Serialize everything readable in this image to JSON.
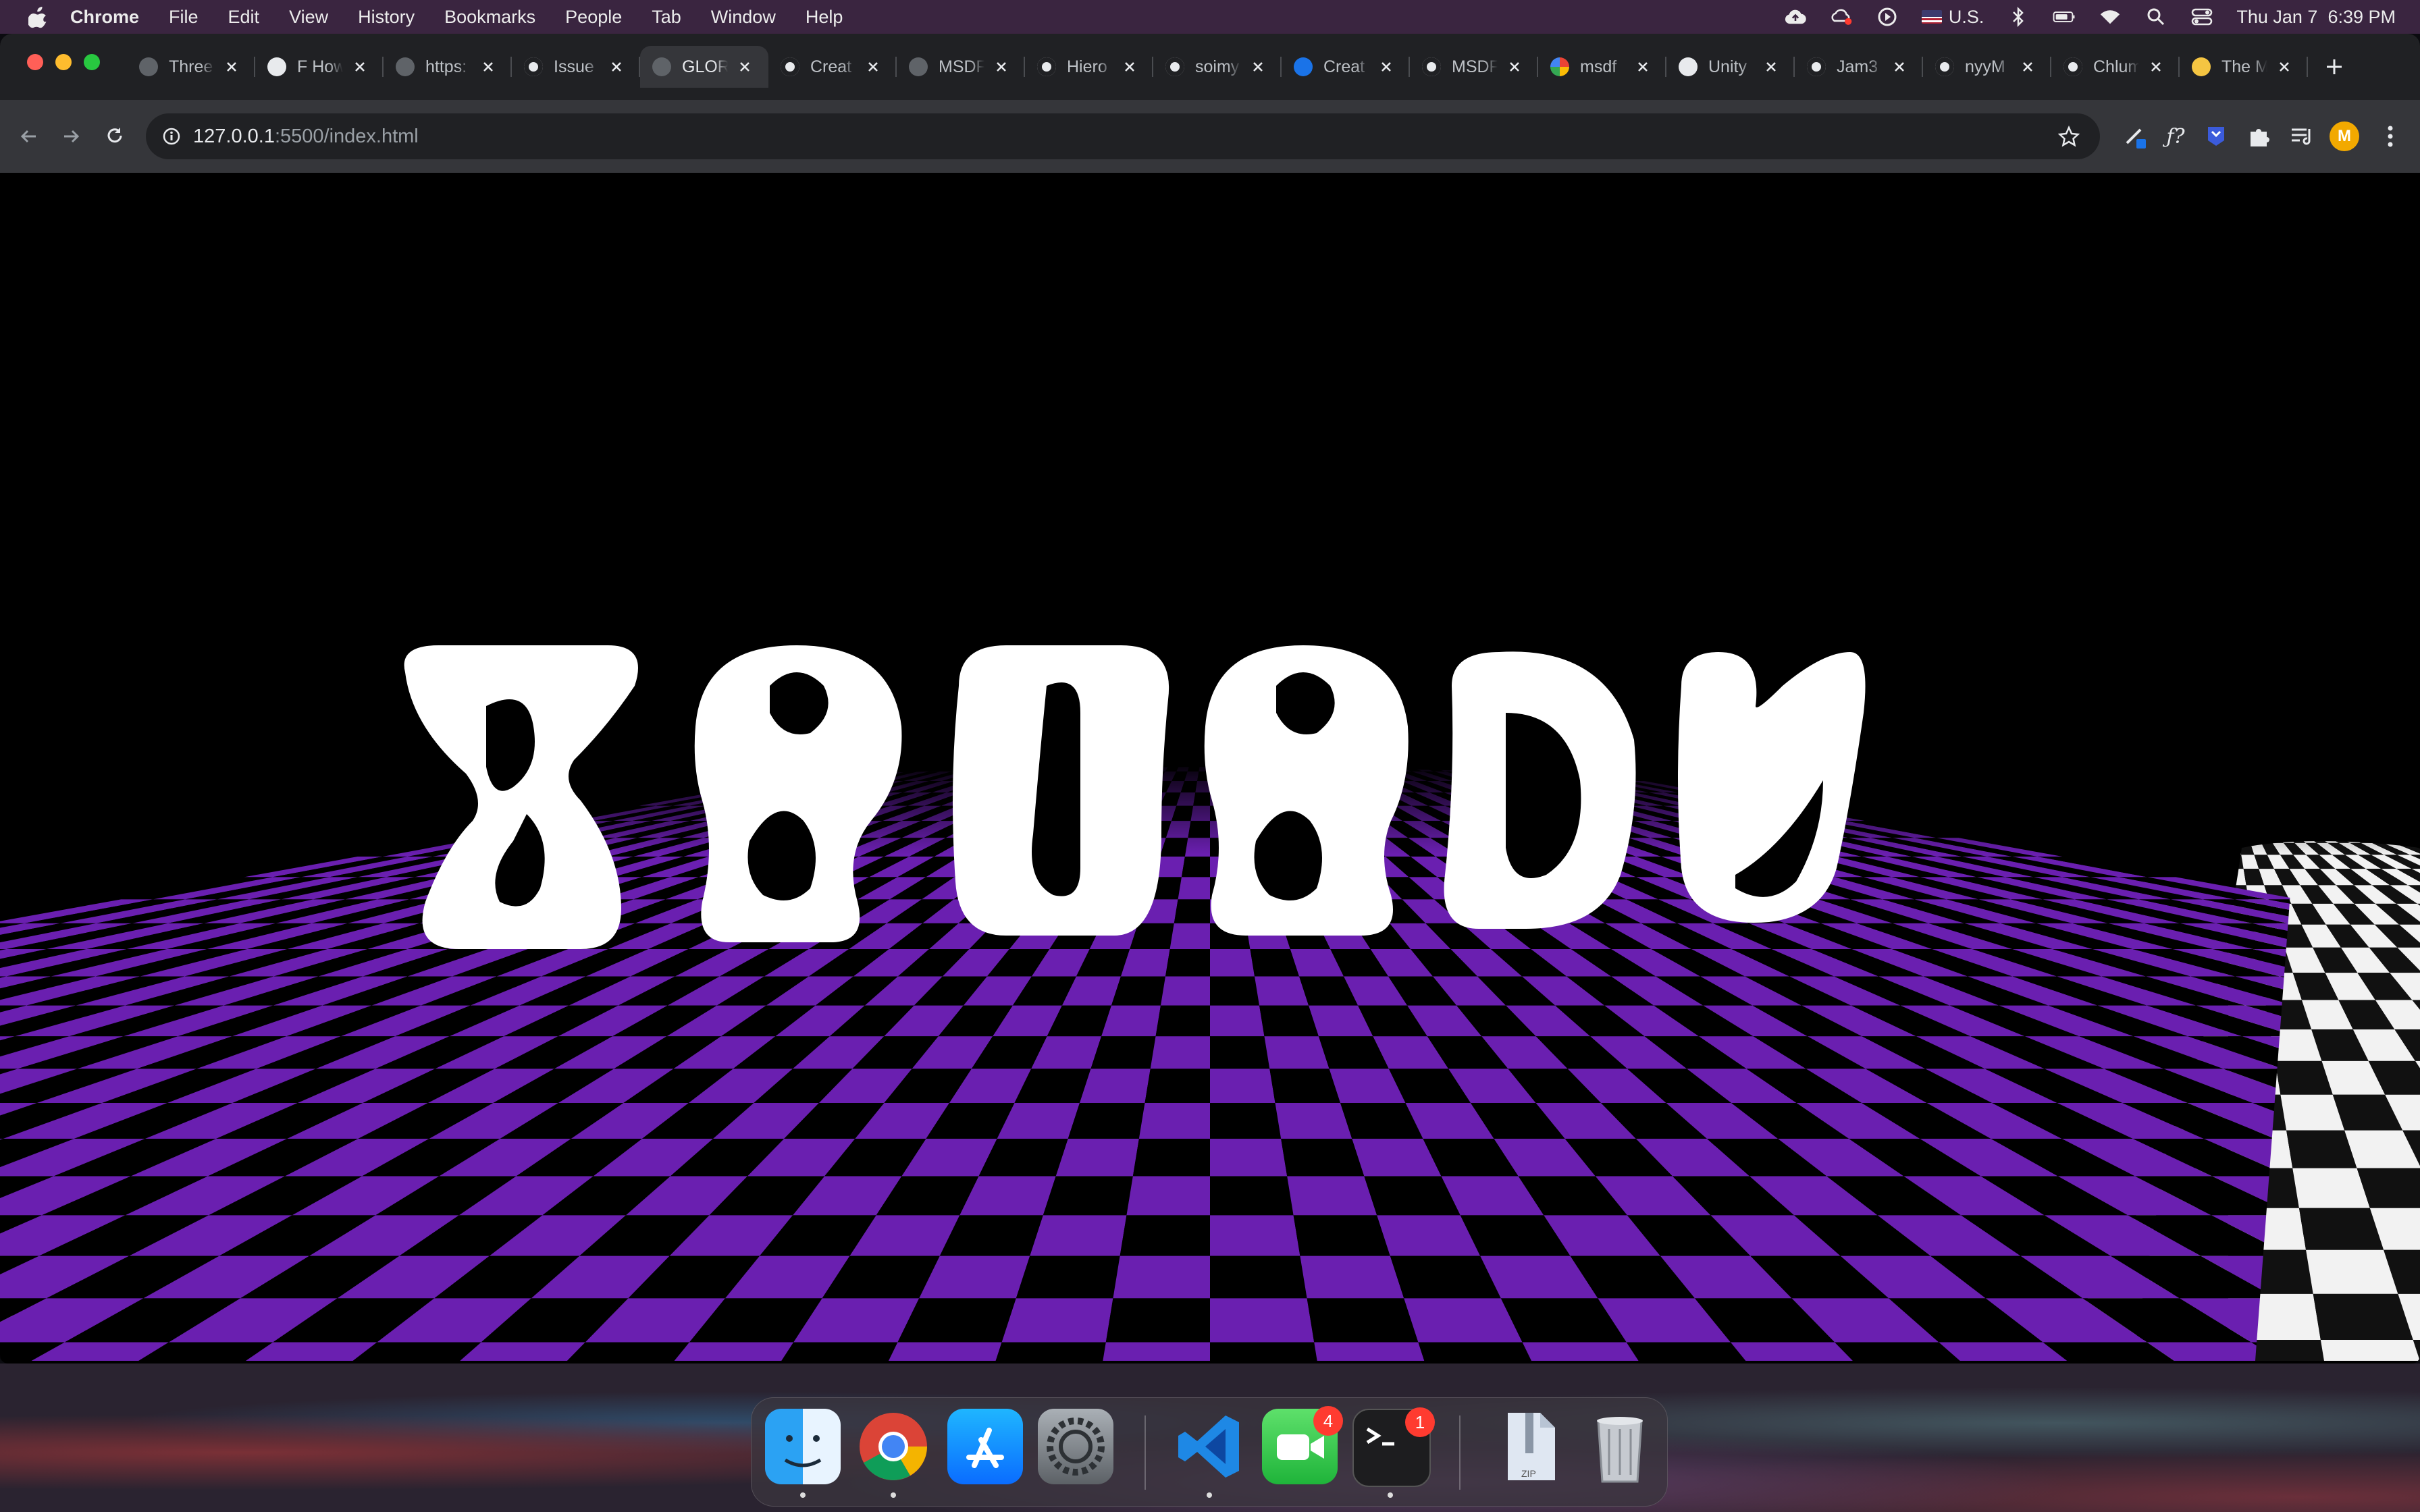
{
  "menubar": {
    "app_name": "Chrome",
    "items": [
      "File",
      "Edit",
      "View",
      "History",
      "Bookmarks",
      "People",
      "Tab",
      "Window",
      "Help"
    ],
    "status": {
      "keyboard_layout": "U.S.",
      "clock": "Thu Jan 7  6:39 PM",
      "icons": [
        "icloud-upload-icon",
        "creative-cloud-icon",
        "play-circle-icon",
        "flag-icon",
        "bluetooth-icon",
        "battery-icon",
        "wifi-icon",
        "spotlight-icon",
        "control-center-icon"
      ]
    }
  },
  "browser": {
    "tabs": [
      {
        "title": "Three",
        "icon": "globe-icon",
        "active": false
      },
      {
        "title": "F How",
        "icon": "page-icon",
        "active": false
      },
      {
        "title": "https:",
        "icon": "globe-icon",
        "active": false
      },
      {
        "title": "Issue",
        "icon": "github-icon",
        "active": false
      },
      {
        "title": "GLOR",
        "icon": "globe-icon",
        "active": true
      },
      {
        "title": "Creat",
        "icon": "github-icon",
        "active": false
      },
      {
        "title": "MSDF",
        "icon": "globe-icon",
        "active": false
      },
      {
        "title": "Hiero",
        "icon": "github-icon",
        "active": false
      },
      {
        "title": "soimy",
        "icon": "github-icon",
        "active": false
      },
      {
        "title": "Creat",
        "icon": "blue-circle-icon",
        "active": false
      },
      {
        "title": "MSDF",
        "icon": "github-icon",
        "active": false
      },
      {
        "title": "msdf",
        "icon": "google-icon",
        "active": false
      },
      {
        "title": "Unity",
        "icon": "unity-icon",
        "active": false
      },
      {
        "title": "Jam3",
        "icon": "github-icon",
        "active": false
      },
      {
        "title": "nyyM",
        "icon": "github-icon",
        "active": false
      },
      {
        "title": "Chlum",
        "icon": "github-icon",
        "active": false
      },
      {
        "title": "The M",
        "icon": "bottle-icon",
        "active": false
      }
    ],
    "url_host": "127.0.0.1",
    "url_path": ":5500/index.html",
    "profile_initial": "M"
  },
  "page": {
    "headline": "XANADU",
    "floor_color": "#6a1fb0",
    "floor_dark": "#000000",
    "background": "#000000"
  },
  "dock": {
    "apps": [
      {
        "name": "Finder",
        "icon": "finder-icon",
        "badge": null,
        "running": true
      },
      {
        "name": "Google Chrome",
        "icon": "chrome-icon",
        "badge": null,
        "running": true
      },
      {
        "name": "App Store",
        "icon": "app-store-icon",
        "badge": null,
        "running": false
      },
      {
        "name": "System Preferences",
        "icon": "system-preferences-icon",
        "badge": null,
        "running": false
      },
      {
        "name": "Visual Studio Code",
        "icon": "vscode-icon",
        "badge": null,
        "running": true
      },
      {
        "name": "FaceTime",
        "icon": "facetime-icon",
        "badge": "4",
        "running": false
      },
      {
        "name": "Terminal",
        "icon": "terminal-icon",
        "badge": "1",
        "running": true
      },
      {
        "name": "Archive",
        "icon": "zip-file-icon",
        "badge": null,
        "running": false
      },
      {
        "name": "Trash",
        "icon": "trash-icon",
        "badge": null,
        "running": false
      }
    ],
    "zip_label": "ZIP"
  }
}
